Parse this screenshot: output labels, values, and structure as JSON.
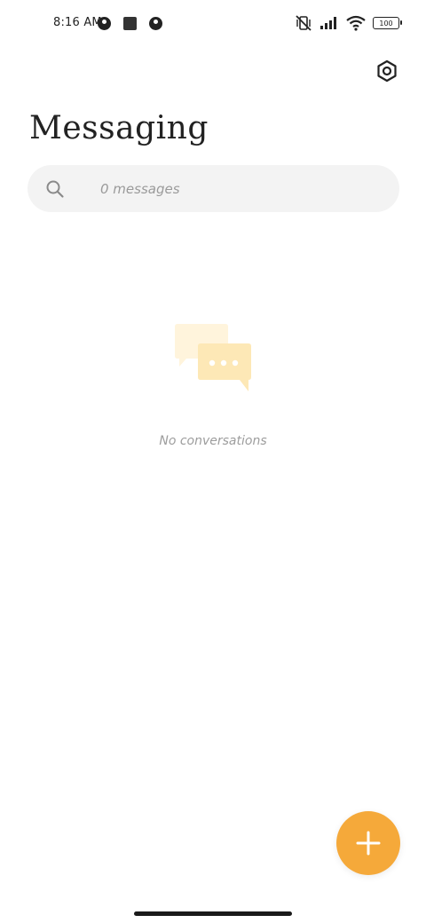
{
  "status_bar": {
    "time": "8:16 AM",
    "battery": "100"
  },
  "header": {
    "title": "Messaging"
  },
  "search": {
    "placeholder": "0 messages"
  },
  "empty_state": {
    "text": "No conversations"
  },
  "colors": {
    "accent": "#f5a93a",
    "illustration_light": "#fff4dc",
    "illustration_dark": "#fde8b6",
    "search_bg": "#f3f3f3"
  },
  "icons": {
    "settings": "gear-icon",
    "search": "search-icon",
    "fab": "plus-icon"
  }
}
